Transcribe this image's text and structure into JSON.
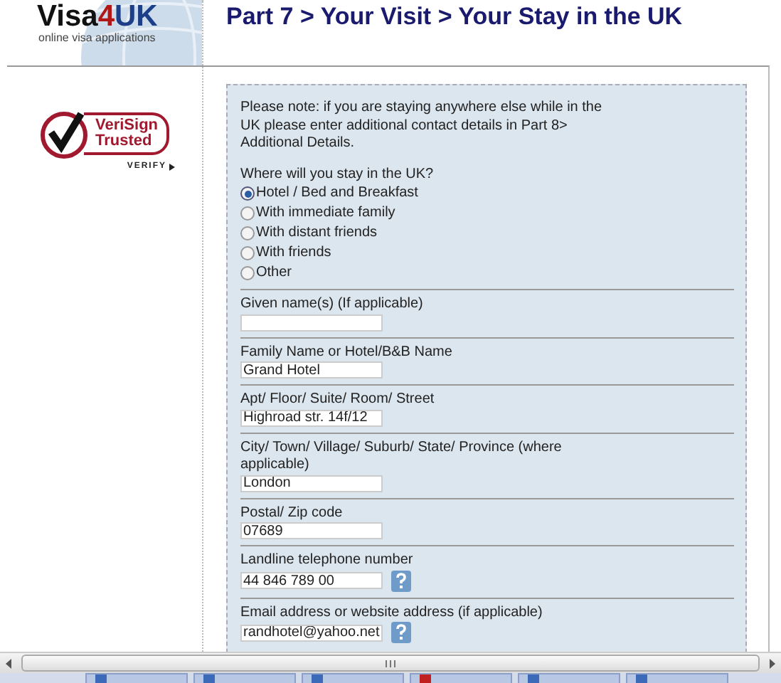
{
  "logo": {
    "parts": [
      "Visa",
      "4",
      "UK"
    ],
    "tagline": "online visa applications"
  },
  "page_title": "Part 7 > Your Visit > Your Stay in the UK",
  "badge": {
    "line1": "VeriSign",
    "line2": "Trusted",
    "verify": "VERIFY"
  },
  "note": "Please note: if you are staying anywhere else while in the UK please enter additional contact details in Part 8> Additional Details.",
  "question": "Where will you stay in the UK?",
  "options": [
    {
      "label": "Hotel / Bed and Breakfast",
      "selected": true
    },
    {
      "label": "With immediate family",
      "selected": false
    },
    {
      "label": "With distant friends",
      "selected": false
    },
    {
      "label": "With friends",
      "selected": false
    },
    {
      "label": "Other",
      "selected": false
    }
  ],
  "fields": [
    {
      "label": "Given name(s) (If applicable)",
      "help": false
    },
    {
      "label": "Family Name or Hotel/B&B Name",
      "value": "Grand Hotel",
      "help": false
    },
    {
      "label": "Apt/ Floor/ Suite/ Room/ Street",
      "value": "Highroad str. 14f/12",
      "help": false
    },
    {
      "label": "City/ Town/ Village/ Suburb/ State/ Province (where applicable)",
      "value": "London",
      "help": false
    },
    {
      "label": "Postal/ Zip code",
      "value": "07689",
      "help": false
    },
    {
      "label": "Landline telephone number",
      "value": "44 846 789 00",
      "help": true
    },
    {
      "label": "Email address or website address (if applicable)",
      "value": "randhotel@yahoo.net",
      "help": true
    }
  ],
  "taskbar": {
    "buttons": [
      {
        "kind": "ie"
      },
      {
        "kind": "ie"
      },
      {
        "kind": "ie"
      },
      {
        "kind": "pdf"
      },
      {
        "kind": "ie"
      },
      {
        "kind": "ie"
      }
    ]
  }
}
